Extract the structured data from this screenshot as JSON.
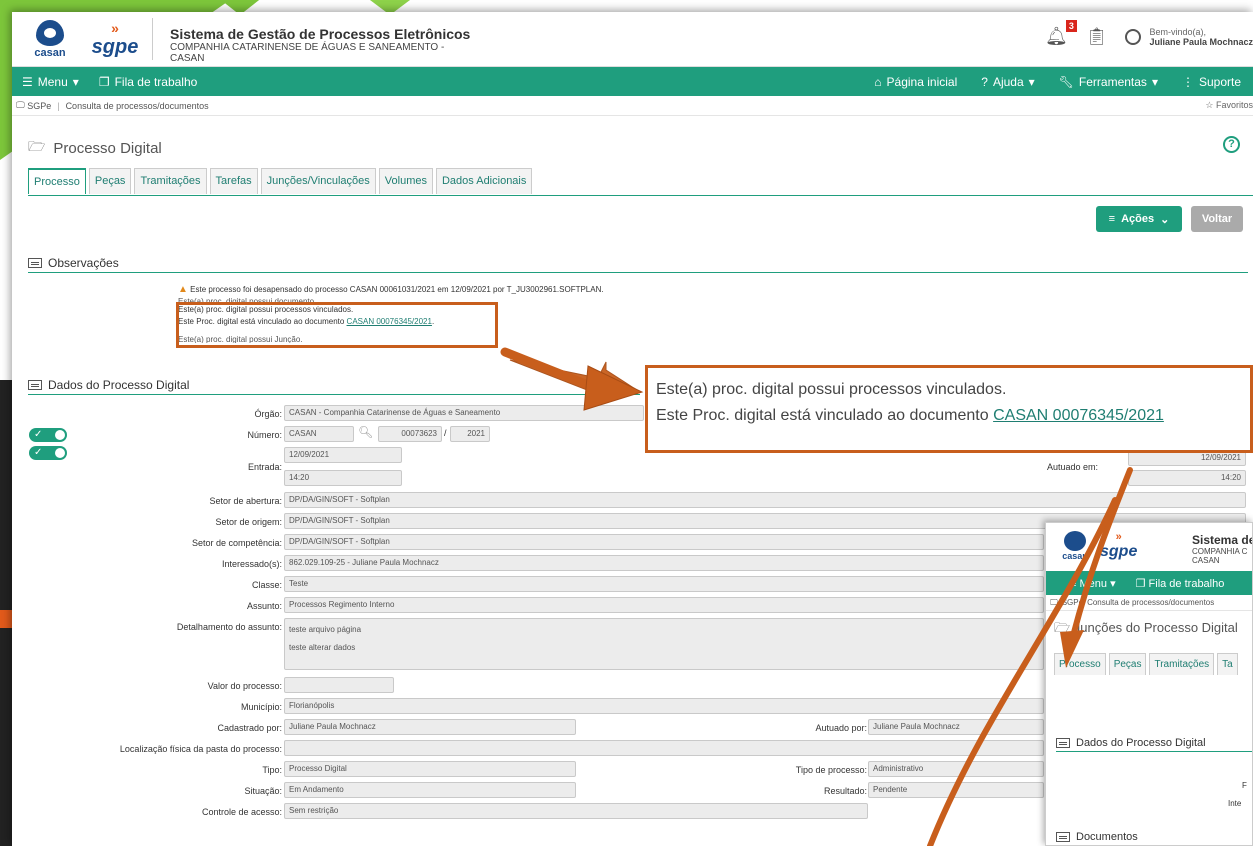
{
  "header": {
    "logo_casan": "casan",
    "logo_sgpe": "sgpe",
    "system_title": "Sistema de Gestão de Processos Eletrônicos",
    "company": "COMPANHIA CATARINENSE DE ÁGUAS E SANEAMENTO - CASAN",
    "notifications_count": "3",
    "welcome": "Bem-vindo(a),",
    "user_name": "Juliane Paula Mochnacz"
  },
  "nav": {
    "menu": "Menu",
    "queue": "Fila de trabalho",
    "home": "Página inicial",
    "help": "Ajuda",
    "tools": "Ferramentas",
    "support": "Suporte"
  },
  "breadcrumb": {
    "root": "SGPe",
    "current": "Consulta de processos/documentos",
    "favorites": "Favoritos"
  },
  "page": {
    "title": "Processo Digital",
    "tabs": [
      "Processo",
      "Peças",
      "Tramitações",
      "Tarefas",
      "Junções/Vinculações",
      "Volumes",
      "Dados Adicionais"
    ],
    "actions_button": "Ações",
    "back_button": "Voltar"
  },
  "observations": {
    "title": "Observações",
    "line1": "Este processo foi desapensado do processo CASAN 00061031/2021 em 12/09/2021 por T_JU3002961.SOFTPLAN.",
    "line2": "Este(a) proc. digital possui documento.",
    "line3": "Este(a) proc. digital possui processos vinculados.",
    "line4_prefix": "Este Proc. digital está vinculado ao documento ",
    "line4_link": "CASAN 00076345/2021",
    "line4_suffix": ".",
    "line5": "Este(a) proc. digital possui Junção."
  },
  "callout": {
    "line1": "Este(a) proc. digital possui processos vinculados.",
    "line2_prefix": "Este Proc. digital está vinculado ao documento ",
    "line2_link": "CASAN 00076345/2021"
  },
  "process": {
    "section_title": "Dados do Processo Digital",
    "orgao_label": "Órgão:",
    "orgao": "CASAN - Companhia Catarinense de Águas e Saneamento",
    "numero_label": "Número:",
    "numero_prefix": "CASAN",
    "numero": "00073623",
    "numero_year": "2021",
    "entrada_label": "Entrada:",
    "entrada_date": "12/09/2021",
    "entrada_time": "14:20",
    "autuado_em_label": "Autuado em:",
    "autuado_date": "12/09/2021",
    "autuado_time": "14:20",
    "setor_abertura_label": "Setor de abertura:",
    "setor_abertura": "DP/DA/GIN/SOFT - Softplan",
    "setor_origem_label": "Setor de origem:",
    "setor_origem": "DP/DA/GIN/SOFT - Softplan",
    "setor_competencia_label": "Setor de competência:",
    "setor_competencia": "DP/DA/GIN/SOFT - Softplan",
    "interessados_label": "Interessado(s):",
    "interessados": "862.029.109-25 - Juliane Paula Mochnacz",
    "classe_label": "Classe:",
    "classe": "Teste",
    "assunto_label": "Assunto:",
    "assunto": "Processos Regimento Interno",
    "detalhamento_label": "Detalhamento do assunto:",
    "detalhamento_l1": "teste arquivo página",
    "detalhamento_l2": "teste alterar dados",
    "valor_label": "Valor do processo:",
    "valor": "",
    "municipio_label": "Município:",
    "municipio": "Florianópolis",
    "cadastrado_label": "Cadastrado por:",
    "cadastrado": "Juliane Paula Mochnacz",
    "autuado_por_label": "Autuado por:",
    "autuado_por": "Juliane Paula Mochnacz",
    "localizacao_label": "Localização física da pasta do processo:",
    "localizacao": "",
    "tipo_label": "Tipo:",
    "tipo": "Processo Digital",
    "tipo_processo_label": "Tipo de processo:",
    "tipo_processo": "Administrativo",
    "situacao_label": "Situação:",
    "situacao": "Em Andamento",
    "resultado_label": "Resultado:",
    "resultado": "Pendente",
    "controle_label": "Controle de acesso:",
    "controle": "Sem restrição"
  },
  "overlay": {
    "system_title": "Sistema de Gestão",
    "company": "COMPANHIA C",
    "company2": "CASAN",
    "menu": "Menu",
    "queue": "Fila de trabalho",
    "bc_root": "SGPe",
    "bc_current": "Consulta de processos/documentos",
    "title": "Junções do Processo Digital",
    "tabs": [
      "Processo",
      "Peças",
      "Tramitações",
      "Ta"
    ],
    "section1": "Dados do Processo Digital",
    "section2": "Documentos",
    "cut1": "F",
    "cut2": "Inte"
  }
}
